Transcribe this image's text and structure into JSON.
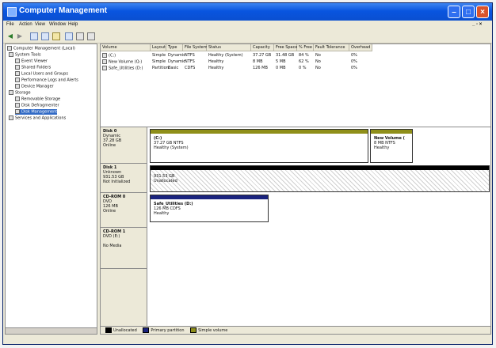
{
  "window": {
    "title": "Computer Management"
  },
  "menu": [
    "File",
    "Action",
    "View",
    "Window",
    "Help"
  ],
  "tree": [
    {
      "label": "Computer Management (Local)",
      "level": 0
    },
    {
      "label": "System Tools",
      "level": 1
    },
    {
      "label": "Event Viewer",
      "level": 2
    },
    {
      "label": "Shared Folders",
      "level": 2
    },
    {
      "label": "Local Users and Groups",
      "level": 2
    },
    {
      "label": "Performance Logs and Alerts",
      "level": 2
    },
    {
      "label": "Device Manager",
      "level": 2
    },
    {
      "label": "Storage",
      "level": 1
    },
    {
      "label": "Removable Storage",
      "level": 2
    },
    {
      "label": "Disk Defragmenter",
      "level": 2
    },
    {
      "label": "Disk Management",
      "level": 2
    },
    {
      "label": "Services and Applications",
      "level": 1
    }
  ],
  "volume_table": {
    "columns": [
      "Volume",
      "Layout",
      "Type",
      "File System",
      "Status",
      "Capacity",
      "Free Space",
      "% Free",
      "Fault Tolerance",
      "Overhead"
    ],
    "rows": [
      [
        "(C:)",
        "Simple",
        "Dynamic",
        "NTFS",
        "Healthy (System)",
        "37.27 GB",
        "31.48 GB",
        "84 %",
        "No",
        "0%"
      ],
      [
        "New Volume (Q:)",
        "Simple",
        "Dynamic",
        "NTFS",
        "Healthy",
        "8 MB",
        "5 MB",
        "62 %",
        "No",
        "0%"
      ],
      [
        "Safe_Utilities (D:)",
        "Partition",
        "Basic",
        "CDFS",
        "Healthy",
        "126 MB",
        "0 MB",
        "0 %",
        "No",
        "0%"
      ]
    ]
  },
  "disks": [
    {
      "name": "Disk 0",
      "lines": [
        "Dynamic",
        "37.28 GB",
        "Online"
      ],
      "partitions": [
        {
          "title": "(C:)",
          "lines": [
            "37.27 GB NTFS",
            "Healthy (System)"
          ],
          "color": "#8f8f1a"
        },
        {
          "title": "New Volume (",
          "lines": [
            "8 MB NTFS",
            "Healthy"
          ],
          "color": "#8f8f1a"
        }
      ]
    },
    {
      "name": "Disk 1",
      "lines": [
        "Unknown",
        "931.53 GB",
        "Not Initialized"
      ],
      "partitions": [
        {
          "title": "",
          "lines": [
            "931.53 GB",
            "Unallocated"
          ],
          "color": "#000000"
        }
      ]
    },
    {
      "name": "CD-ROM 0",
      "lines": [
        "DVD",
        "126 MB",
        "Online"
      ],
      "partitions": [
        {
          "title": "Safe_Utilities (D:)",
          "lines": [
            "126 MB CDFS",
            "Healthy"
          ],
          "color": "#1a237e"
        }
      ]
    },
    {
      "name": "CD-ROM 1",
      "lines": [
        "DVD (E:)",
        "",
        "No Media"
      ],
      "partitions": []
    }
  ],
  "legend": [
    {
      "label": "Unallocated",
      "color": "#000000"
    },
    {
      "label": "Primary partition",
      "color": "#1a237e"
    },
    {
      "label": "Simple volume",
      "color": "#8f8f1a"
    }
  ]
}
